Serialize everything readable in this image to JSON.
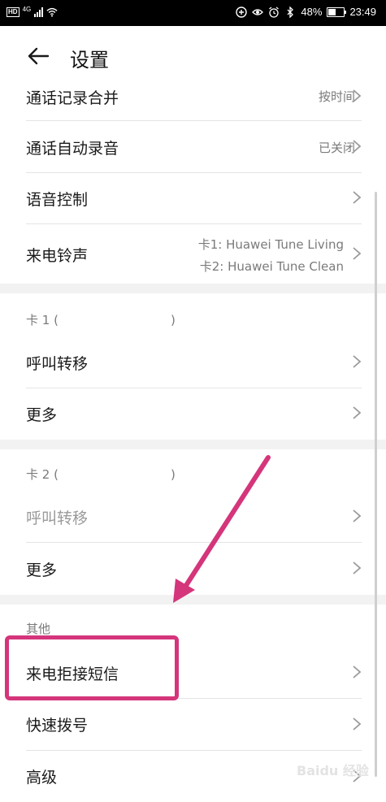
{
  "status_bar": {
    "hd": "HD",
    "network": "4G",
    "battery": "48%",
    "time": "23:49",
    "battery_level": 0.48,
    "icons": [
      "signal-icon",
      "wifi-icon",
      "data-saver-icon",
      "eye-icon",
      "alarm-icon",
      "bluetooth-icon",
      "battery-icon"
    ]
  },
  "header": {
    "title": "设置",
    "back_icon": "back-arrow-icon"
  },
  "rows": {
    "call_log_merge": {
      "label": "通话记录合并",
      "value": "按时间"
    },
    "auto_record": {
      "label": "通话自动录音",
      "value": "已关闭"
    },
    "voice_control": {
      "label": "语音控制"
    },
    "ringtone": {
      "label": "来电铃声",
      "line1": "卡1: Huawei Tune Living",
      "line2": "卡2: Huawei Tune Clean"
    },
    "sim1": {
      "header": "卡 1 (",
      "header_end": ")",
      "forwarding": "呼叫转移",
      "more": "更多"
    },
    "sim2": {
      "header": "卡 2 (",
      "header_end": ")",
      "forwarding": "呼叫转移",
      "more": "更多"
    },
    "other": {
      "header": "其他",
      "reject_sms": "来电拒接短信",
      "speed_dial": "快速拨号",
      "advanced": "高级"
    }
  },
  "annotation": {
    "highlight_color": "#d4357b",
    "arrow_color": "#d4357b"
  },
  "watermark": "Baidu 经验"
}
